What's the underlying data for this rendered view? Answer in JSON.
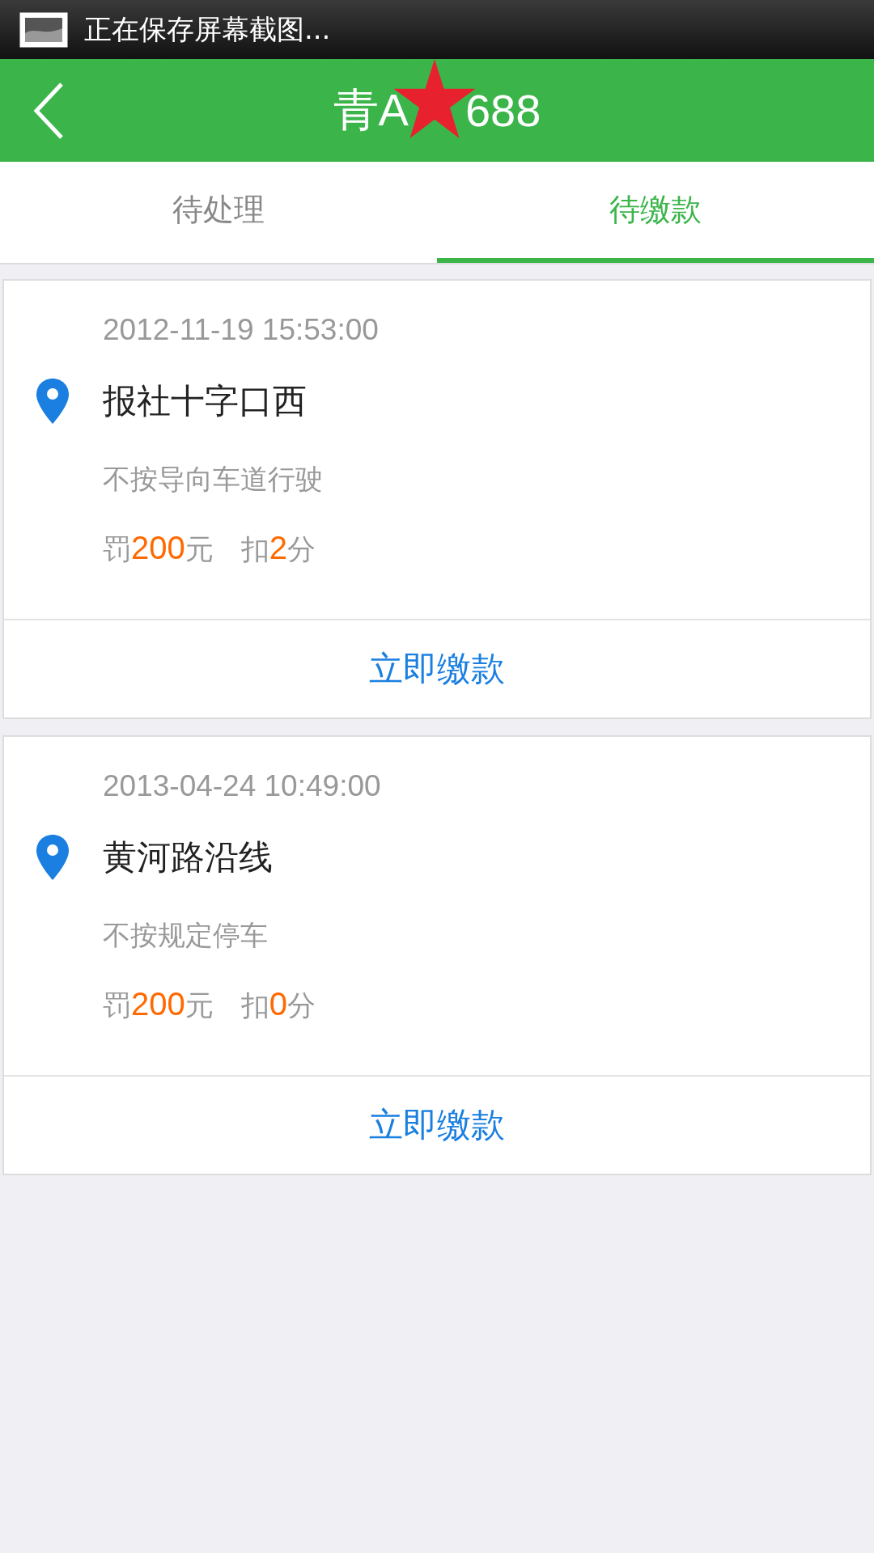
{
  "status_bar": {
    "notification": "正在保存屏幕截图..."
  },
  "header": {
    "title_parts": [
      "青A",
      "688"
    ],
    "redacted": true
  },
  "tabs": [
    {
      "label": "待处理",
      "selected": false
    },
    {
      "label": "待缴款",
      "selected": true
    }
  ],
  "violations": [
    {
      "time": "2012-11-19 15:53:00",
      "place": "报社十字口西",
      "offense": "不按导向车道行驶",
      "fine_prefix": "罚",
      "fine": "200",
      "fine_suffix": "元",
      "points_prefix": "扣",
      "points": "2",
      "points_suffix": "分",
      "action": "立即缴款"
    },
    {
      "time": "2013-04-24 10:49:00",
      "place": "黄河路沿线",
      "offense": "不按规定停车",
      "fine_prefix": "罚",
      "fine": "200",
      "fine_suffix": "元",
      "points_prefix": "扣",
      "points": "0",
      "points_suffix": "分",
      "action": "立即缴款"
    }
  ]
}
